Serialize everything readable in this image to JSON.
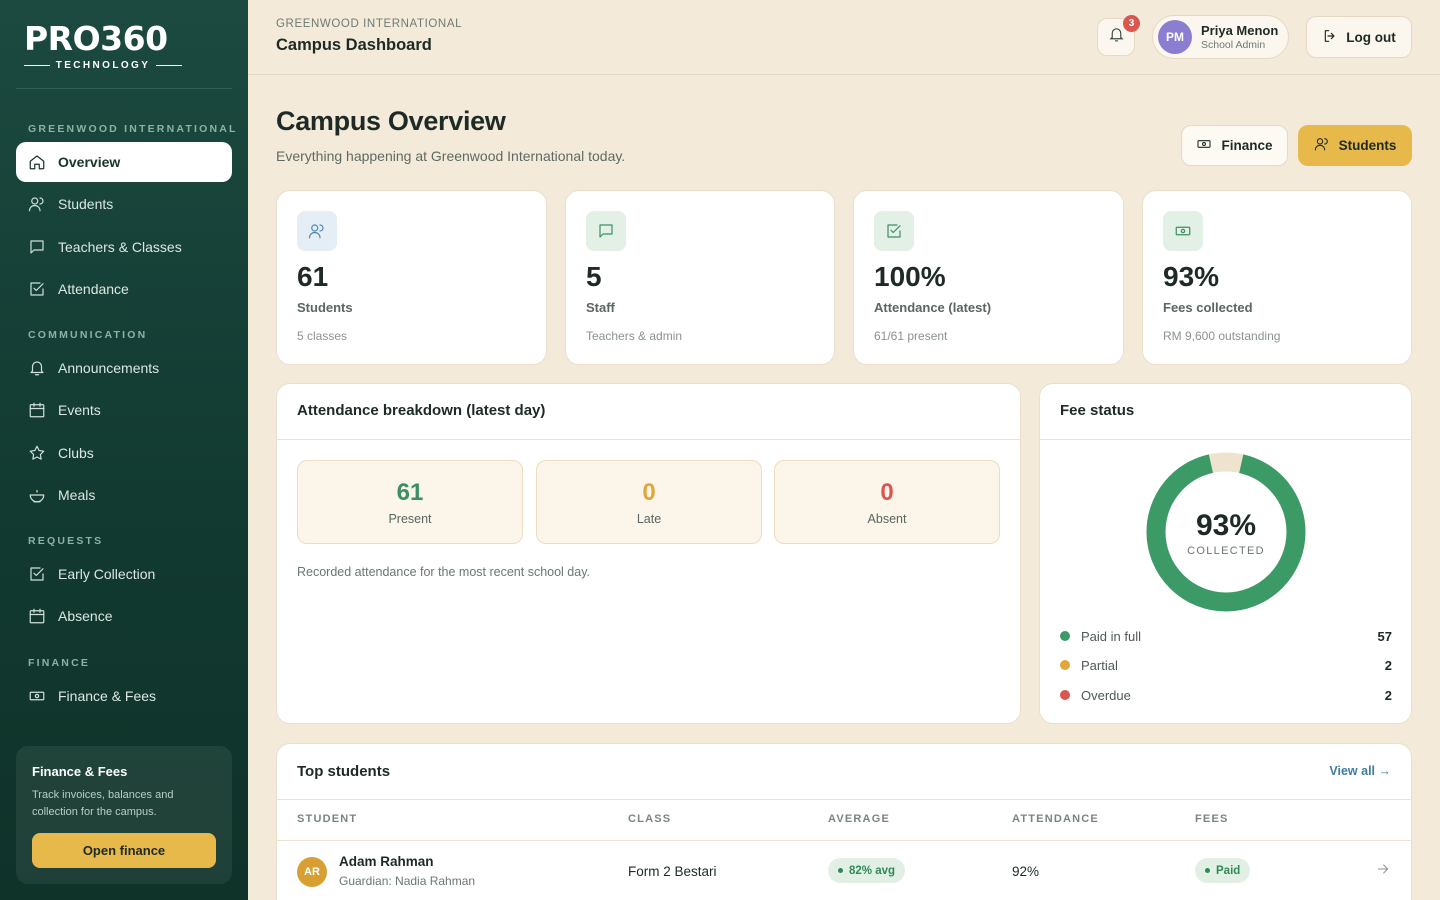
{
  "brand": {
    "logo_main": "PRO360",
    "logo_sub": "TECHNOLOGY"
  },
  "sidebar": {
    "sections": [
      {
        "label": "GREENWOOD INTERNATIONAL"
      },
      {
        "label": "COMMUNICATION"
      },
      {
        "label": "REQUESTS"
      },
      {
        "label": "FINANCE"
      }
    ],
    "items": [
      {
        "label": "Overview",
        "icon": "home-icon",
        "active": true
      },
      {
        "label": "Students",
        "icon": "students-icon"
      },
      {
        "label": "Teachers & Classes",
        "icon": "chat-icon"
      },
      {
        "label": "Attendance",
        "icon": "checkbox-icon"
      },
      {
        "label": "Announcements",
        "icon": "bell-icon"
      },
      {
        "label": "Events",
        "icon": "calendar-icon"
      },
      {
        "label": "Clubs",
        "icon": "star-icon"
      },
      {
        "label": "Meals",
        "icon": "bowl-icon"
      },
      {
        "label": "Early Collection",
        "icon": "checkbox-icon"
      },
      {
        "label": "Absence",
        "icon": "calendar-icon"
      },
      {
        "label": "Finance & Fees",
        "icon": "cash-icon"
      }
    ],
    "promo": {
      "title": "Finance & Fees",
      "text": "Track invoices, balances and collection for the campus.",
      "button": "Open finance"
    }
  },
  "header": {
    "breadcrumb": "GREENWOOD INTERNATIONAL",
    "title": "Campus Dashboard",
    "notifications": "3",
    "user": {
      "initials": "PM",
      "name": "Priya Menon",
      "role": "School Admin"
    },
    "logout": "Log out"
  },
  "page": {
    "title": "Campus Overview",
    "subtitle": "Everything happening at Greenwood International today.",
    "finance_button": "Finance",
    "students_button": "Students"
  },
  "stats": [
    {
      "value": "61",
      "label": "Students",
      "sub": "5 classes",
      "icon": "students-icon",
      "color": "#4f86b3",
      "bg": "#e5eef5"
    },
    {
      "value": "5",
      "label": "Staff",
      "sub": "Teachers & admin",
      "icon": "chat-icon",
      "color": "#3c8f63",
      "bg": "#e2f0e6"
    },
    {
      "value": "100%",
      "label": "Attendance (latest)",
      "sub": "61/61 present",
      "icon": "checkbox-icon",
      "color": "#3c8f63",
      "bg": "#e2f0e6"
    },
    {
      "value": "93%",
      "label": "Fees collected",
      "sub": "RM 9,600 outstanding",
      "icon": "cash-icon",
      "color": "#3c8f63",
      "bg": "#e2f0e6"
    }
  ],
  "attendance": {
    "title": "Attendance breakdown (latest day)",
    "boxes": [
      {
        "value": "61",
        "label": "Present",
        "color": "#3c8f63"
      },
      {
        "value": "0",
        "label": "Late",
        "color": "#e0a73a"
      },
      {
        "value": "0",
        "label": "Absent",
        "color": "#d9574f"
      }
    ],
    "note": "Recorded attendance for the most recent school day."
  },
  "fees": {
    "title": "Fee status",
    "percent": "93%",
    "percent_label": "COLLECTED",
    "collected_fraction": 0.93,
    "ring_color": "#3c9a67",
    "rest_color": "#eee3cf",
    "legend": [
      {
        "label": "Paid in full",
        "count": "57",
        "color": "#3c9a67"
      },
      {
        "label": "Partial",
        "count": "2",
        "color": "#e0a73a"
      },
      {
        "label": "Overdue",
        "count": "2",
        "color": "#d9574f"
      }
    ]
  },
  "top_students": {
    "title": "Top students",
    "view_all": "View all →",
    "columns": [
      "STUDENT",
      "CLASS",
      "AVERAGE",
      "ATTENDANCE",
      "FEES"
    ],
    "rows": [
      {
        "initials": "AR",
        "name": "Adam Rahman",
        "guardian": "Guardian: Nadia Rahman",
        "class": "Form 2 Bestari",
        "average": "82% avg",
        "attendance": "92%",
        "fees": "Paid"
      }
    ]
  }
}
